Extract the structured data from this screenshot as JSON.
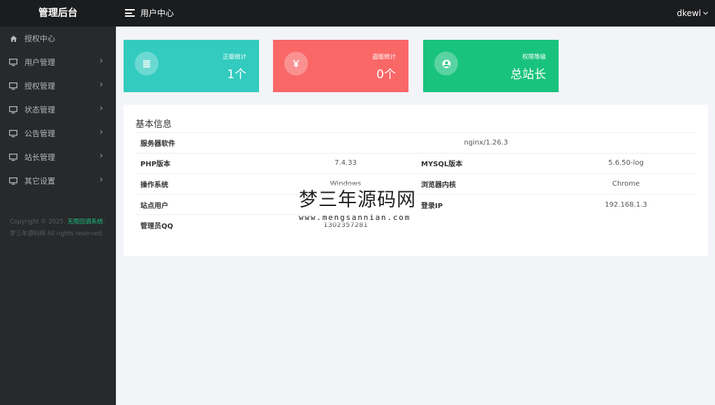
{
  "header": {
    "brand": "管理后台",
    "page_title": "用户中心",
    "username": "dkewl"
  },
  "sidebar": {
    "items": [
      {
        "label": "授权中心",
        "icon": "home-icon",
        "has_submenu": false
      },
      {
        "label": "用户管理",
        "icon": "monitor-icon",
        "has_submenu": true
      },
      {
        "label": "授权管理",
        "icon": "monitor-icon",
        "has_submenu": true
      },
      {
        "label": "状态管理",
        "icon": "monitor-icon",
        "has_submenu": true
      },
      {
        "label": "公告管理",
        "icon": "monitor-icon",
        "has_submenu": true
      },
      {
        "label": "站长管理",
        "icon": "monitor-icon",
        "has_submenu": true
      },
      {
        "label": "其它设置",
        "icon": "monitor-icon",
        "has_submenu": true
      }
    ],
    "copyright_prefix": "Copyright © 2025. ",
    "copyright_brand": "无限回调系统",
    "copyright_site": "-梦三年源码网",
    "copyright_suffix": " All rights reserved."
  },
  "stats": [
    {
      "label": "正版统计",
      "value": "1个",
      "icon": "list-icon",
      "color": "#33cbbf"
    },
    {
      "label": "盗版统计",
      "value": "0个",
      "icon": "yen-icon",
      "color": "#f96767"
    },
    {
      "label": "权限等级",
      "value": "总站长",
      "icon": "user-circle-icon",
      "color": "#19c37d"
    }
  ],
  "info": {
    "title": "基本信息",
    "server_label": "服务器软件",
    "server_value": "nginx/1.26.3",
    "php_label": "PHP版本",
    "php_value": "7.4.33",
    "mysql_label": "MYSQL版本",
    "mysql_value": "5.6.50-log",
    "os_label": "操作系统",
    "os_value": "Windows",
    "browser_label": "浏览器内核",
    "browser_value": "Chrome",
    "site_user_label": "站点用户",
    "site_user_value": "",
    "login_ip_label": "登录IP",
    "login_ip_value": "192.168.1.3",
    "admin_qq_label": "管理员QQ",
    "admin_qq_value": "1302357281"
  },
  "watermark": {
    "chinese": "梦三年源码网",
    "url": "www.mengsannian.com"
  }
}
